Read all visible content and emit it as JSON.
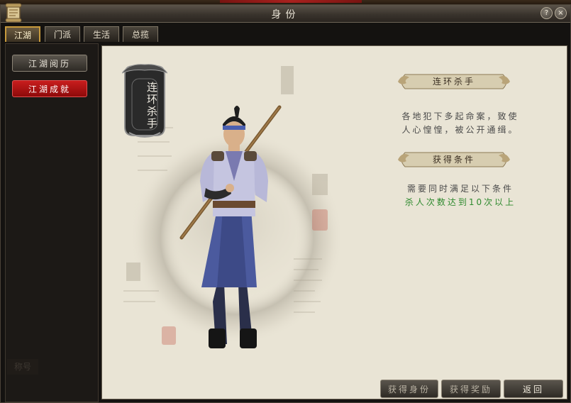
{
  "window": {
    "title": "身份"
  },
  "titlebar_buttons": {
    "help": "?",
    "close": "×"
  },
  "tabs": [
    {
      "label": "江湖",
      "active": true
    },
    {
      "label": "门派",
      "active": false
    },
    {
      "label": "生活",
      "active": false
    },
    {
      "label": "总揽",
      "active": false
    }
  ],
  "sidebar": {
    "items": [
      {
        "label": "江湖阅历",
        "selected": false
      },
      {
        "label": "江湖成就",
        "selected": true
      }
    ],
    "faded_label": "称号"
  },
  "title_badge": {
    "text": "连环杀手"
  },
  "detail": {
    "title_banner": "连环杀手",
    "description_line1": "各地犯下多起命案，致使",
    "description_line2": "人心惶惶，被公开通缉。",
    "condition_banner": "获得条件",
    "condition_intro": "需要同时满足以下条件",
    "condition_item": "杀人次数达到10次以上"
  },
  "buttons": {
    "get_identity": "获得身份",
    "get_reward": "获得奖励",
    "back": "返回"
  },
  "colors": {
    "accent_red": "#b01414",
    "tab_active_border": "#c79a3c",
    "condition_green": "#2f8a2f",
    "parchment": "#e9e4d5"
  }
}
